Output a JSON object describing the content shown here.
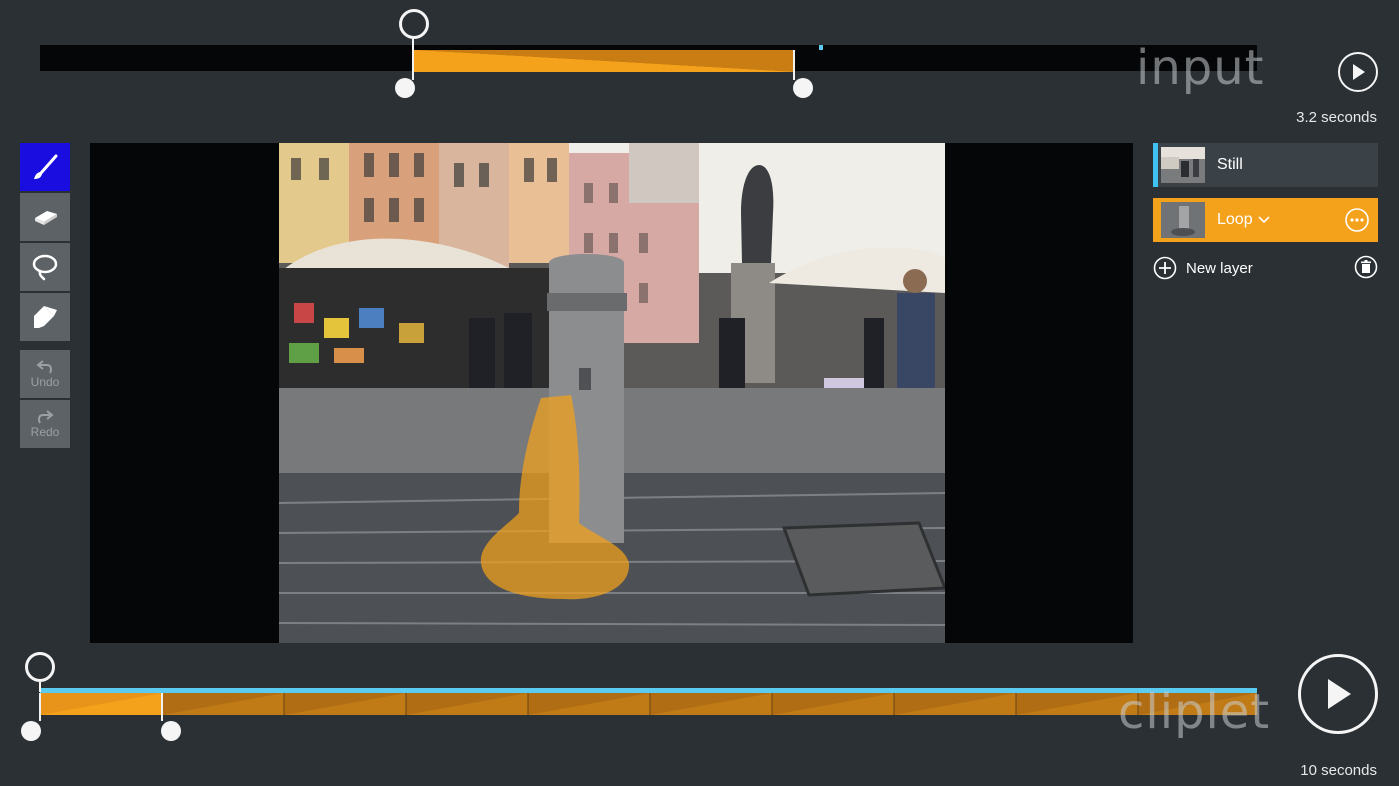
{
  "input_timeline": {
    "label": "input",
    "duration": "3.2 seconds"
  },
  "tools": {
    "brush": "brush-icon",
    "eraser": "eraser-icon",
    "lasso": "lasso-icon",
    "fill": "fill-icon",
    "undo_label": "Undo",
    "redo_label": "Redo"
  },
  "layers": {
    "items": [
      {
        "label": "Still"
      },
      {
        "label": "Loop"
      }
    ],
    "new_layer_label": "New layer"
  },
  "cliplet_timeline": {
    "label": "cliplet",
    "duration": "10 seconds"
  },
  "colors": {
    "accent": "#f4a11b",
    "active_tool": "#1a0de0",
    "timeline_line": "#5ccbf0",
    "background": "#2a3034"
  }
}
